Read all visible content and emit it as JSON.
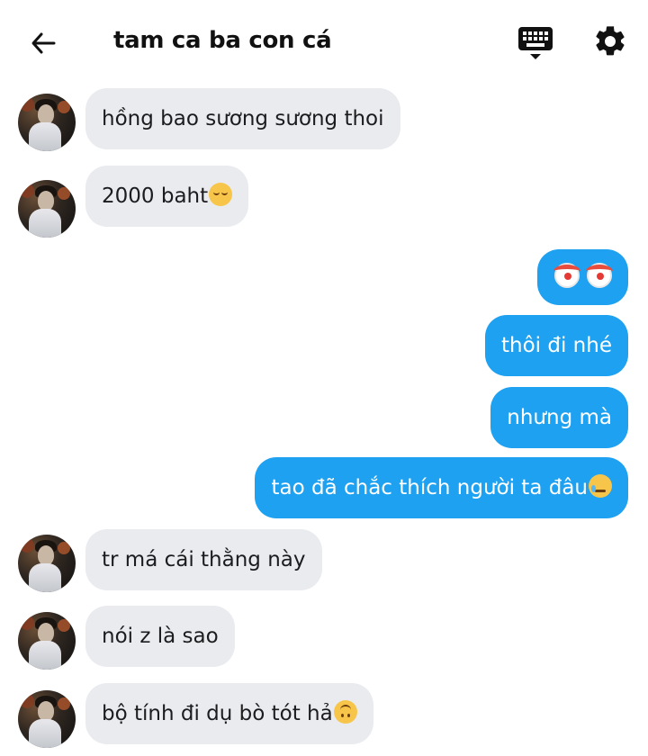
{
  "header": {
    "title": "tam ca ba con cá",
    "icons": {
      "back": "arrow-left-icon",
      "keyboard": "keyboard-icon",
      "settings": "gear-icon"
    }
  },
  "colors": {
    "outgoing_bubble": "#1ea1f1",
    "incoming_bubble": "#e9ebef",
    "outgoing_text": "#ffffff",
    "incoming_text": "#1c1c1e"
  },
  "messages": [
    {
      "direction": "incoming",
      "text": "hồng bao sương sương thoi",
      "emoji": ""
    },
    {
      "direction": "incoming",
      "text": "2000 baht",
      "emoji": "relieved-face"
    },
    {
      "direction": "outgoing",
      "text": "",
      "emoji": "clown-face clown-face"
    },
    {
      "direction": "outgoing",
      "text": "thôi đi nhé",
      "emoji": ""
    },
    {
      "direction": "outgoing",
      "text": "nhưng mà",
      "emoji": ""
    },
    {
      "direction": "outgoing",
      "text": "tao đã chắc thích người ta đâu",
      "emoji": "face-holding-back-tears"
    },
    {
      "direction": "incoming",
      "text": "tr má cái thằng này",
      "emoji": ""
    },
    {
      "direction": "incoming",
      "text": "nói z là sao",
      "emoji": ""
    },
    {
      "direction": "incoming",
      "text": "bộ tính đi dụ bò tót hả",
      "emoji": "upside-down-face"
    }
  ]
}
